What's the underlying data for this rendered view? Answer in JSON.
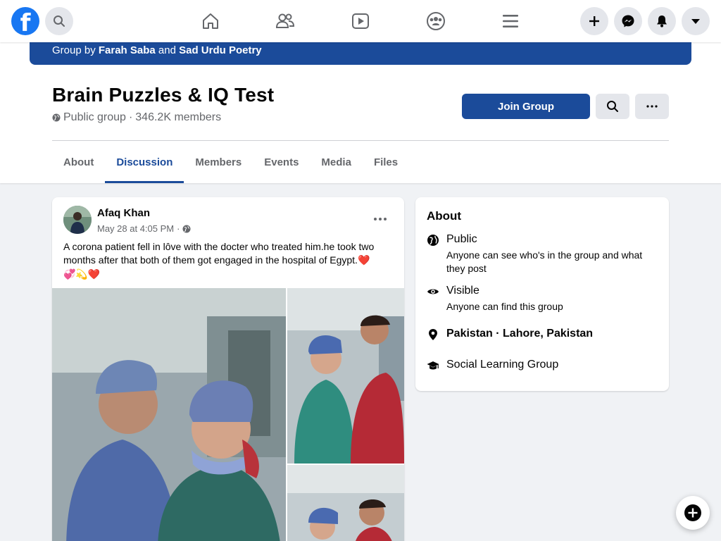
{
  "nav": {
    "logo_letter": "f",
    "icons": [
      "search-icon",
      "home-icon",
      "friends-icon",
      "watch-icon",
      "groups-icon",
      "menu-icon",
      "create-icon",
      "messenger-icon",
      "notifications-icon",
      "account-dropdown-icon"
    ]
  },
  "group": {
    "cover": {
      "prefix": "Group by",
      "owner1": "Farah Saba",
      "conj": "and",
      "owner2": "Sad Urdu Poetry"
    },
    "title": "Brain Puzzles & IQ Test",
    "privacy": "Public group",
    "separator": "·",
    "members": "346.2K members",
    "join_label": "Join Group",
    "tabs": [
      {
        "label": "About"
      },
      {
        "label": "Discussion",
        "active": true
      },
      {
        "label": "Members"
      },
      {
        "label": "Events"
      },
      {
        "label": "Media"
      },
      {
        "label": "Files"
      }
    ]
  },
  "post": {
    "author": "Afaq Khan",
    "timestamp": "May 28 at 4:05 PM",
    "meta_sep": "·",
    "text": "A corona patient fell in lôve with the docter who treated him.he took two months after that both of them got engaged in the hospital of Egypt.",
    "emoji_inline": "❤️",
    "emoji_line": "💞💫❤️"
  },
  "about": {
    "heading": "About",
    "rows": [
      {
        "icon": "globe-icon",
        "title": "Public",
        "subtitle": "Anyone can see who's in the group and what they post"
      },
      {
        "icon": "eye-icon",
        "title": "Visible",
        "subtitle": "Anyone can find this group"
      },
      {
        "icon": "location-pin-icon",
        "title": "Pakistan · Lahore, Pakistan",
        "subtitle": ""
      },
      {
        "icon": "graduation-cap-icon",
        "title": "Social Learning Group",
        "subtitle": ""
      }
    ]
  },
  "colors": {
    "brand": "#1877f2",
    "group_accent": "#1b4b9a",
    "background": "#f0f2f5"
  }
}
